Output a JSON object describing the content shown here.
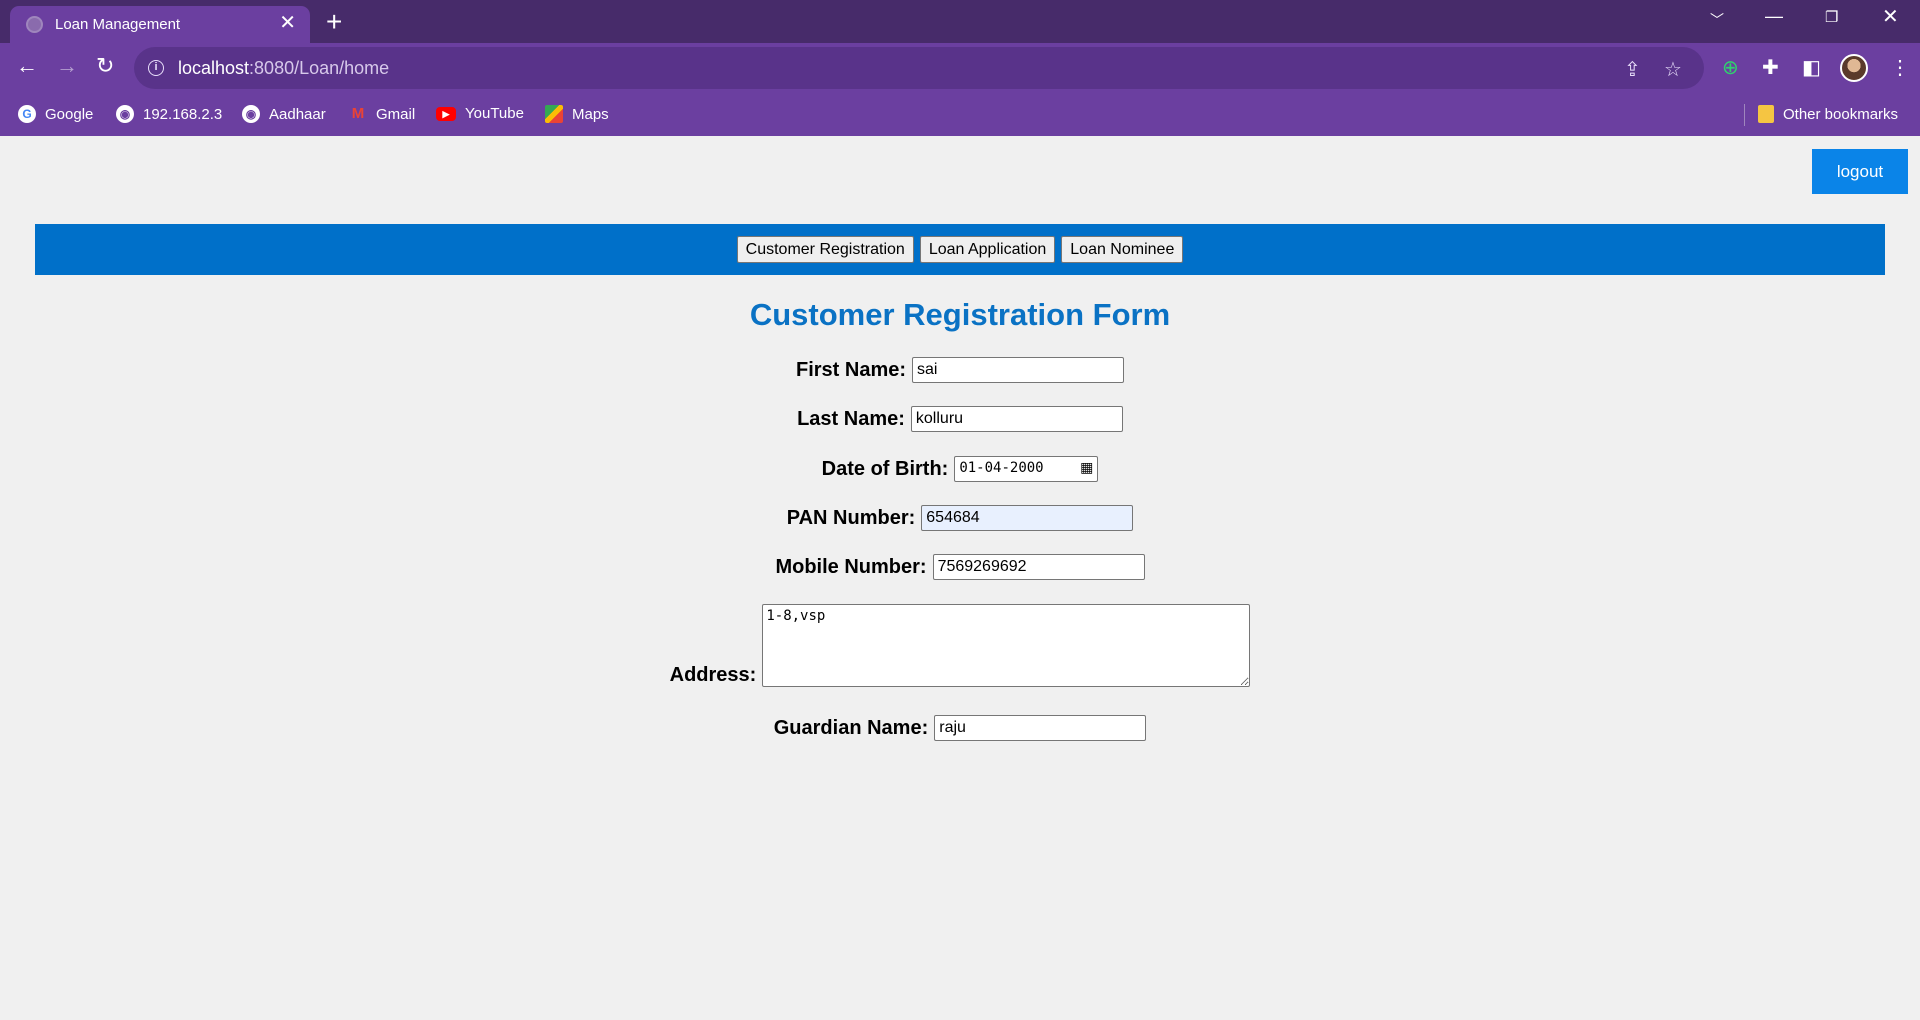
{
  "browser": {
    "tab_title": "Loan Management",
    "tab_close": "✕",
    "new_tab": "+",
    "url_host": "localhost",
    "url_rest": ":8080/Loan/home",
    "bookmarks": [
      {
        "label": "Google",
        "icon": "google-icon"
      },
      {
        "label": "192.168.2.3",
        "icon": "globe-icon"
      },
      {
        "label": "Aadhaar",
        "icon": "globe-icon"
      },
      {
        "label": "Gmail",
        "icon": "gmail-icon"
      },
      {
        "label": "YouTube",
        "icon": "youtube-icon"
      },
      {
        "label": "Maps",
        "icon": "maps-icon"
      }
    ],
    "other_bookmarks": "Other bookmarks"
  },
  "page": {
    "logout_label": "logout",
    "nav": {
      "customer_registration": "Customer Registration",
      "loan_application": "Loan Application",
      "loan_nominee": "Loan Nominee"
    },
    "form_title": "Customer Registration Form",
    "fields": {
      "first_name": {
        "label": "First Name:",
        "value": "sai"
      },
      "last_name": {
        "label": "Last Name:",
        "value": "kolluru"
      },
      "dob": {
        "label": "Date of Birth:",
        "value": "01-04-2000"
      },
      "pan": {
        "label": "PAN Number:",
        "value": "654684"
      },
      "mobile": {
        "label": "Mobile Number:",
        "value": "7569269692"
      },
      "address": {
        "label": "Address:",
        "value": "1-8,vsp"
      },
      "guardian": {
        "label": "Guardian Name:",
        "value": "raju"
      }
    }
  },
  "colors": {
    "tab_strip": "#472b6a",
    "toolbar": "#6b3fa0",
    "nav_bar": "#0070c9",
    "title": "#0a72c4",
    "logout_button": "#0a84e8",
    "page_bg": "#f0f0f0"
  }
}
